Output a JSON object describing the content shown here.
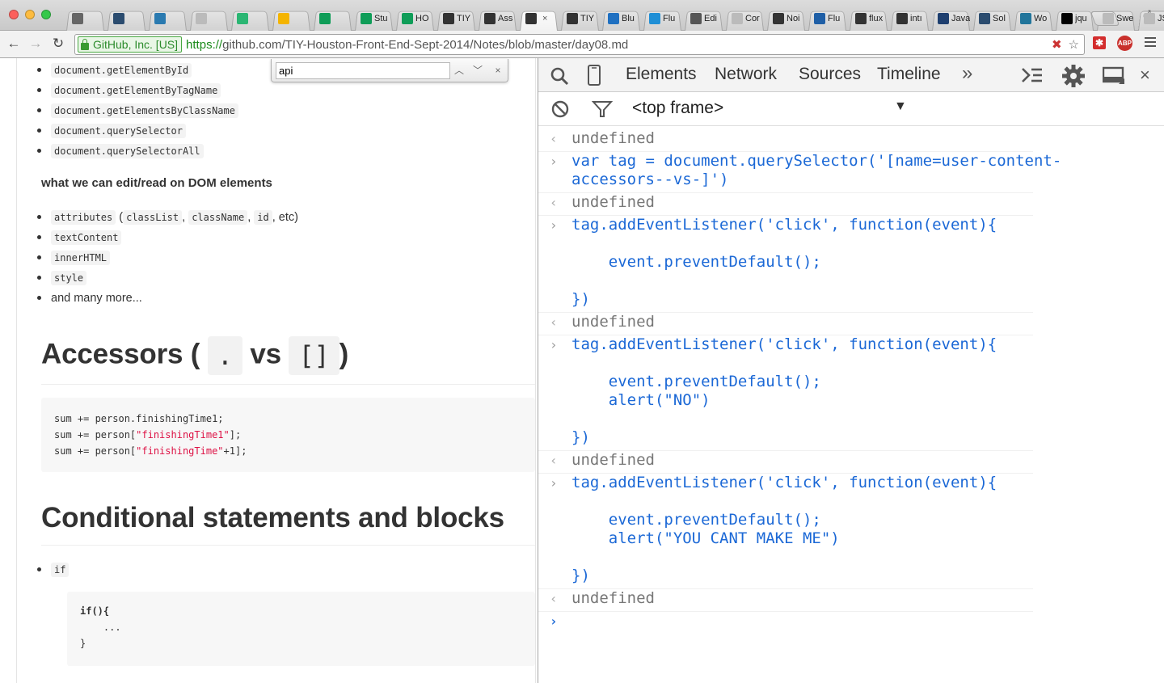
{
  "tabs": [
    {
      "title": "",
      "icon": "home-icon",
      "color": "#666666"
    },
    {
      "title": "",
      "icon": "shield-app-icon",
      "color": "#2b4c6f"
    },
    {
      "title": "",
      "icon": "trello-icon",
      "color": "#2a7ab0"
    },
    {
      "title": "",
      "icon": "document-icon",
      "color": "#bbbbbb"
    },
    {
      "title": "",
      "icon": "cloud-icon",
      "color": "#2bb673"
    },
    {
      "title": "",
      "icon": "drive-icon",
      "color": "#f4b400"
    },
    {
      "title": "",
      "icon": "drive-icon",
      "color": "#0f9d58"
    },
    {
      "title": "Stu",
      "icon": "sheets-icon",
      "color": "#0f9d58"
    },
    {
      "title": "HO",
      "icon": "sheets-icon",
      "color": "#0f9d58"
    },
    {
      "title": "TIY",
      "icon": "github-icon",
      "color": "#333333"
    },
    {
      "title": "Ass",
      "icon": "github-icon",
      "color": "#333333"
    },
    {
      "title": "",
      "icon": "github-icon",
      "color": "#333333",
      "active": true
    },
    {
      "title": "TIY",
      "icon": "github-icon",
      "color": "#333333"
    },
    {
      "title": "Blu",
      "icon": "bluemix-icon",
      "color": "#1f70c1"
    },
    {
      "title": "Flu",
      "icon": "flux-icon",
      "color": "#1f8fd6"
    },
    {
      "title": "Edi",
      "icon": "cloud-icon",
      "color": "#555555"
    },
    {
      "title": "Cor",
      "icon": "document-icon",
      "color": "#bbbbbb"
    },
    {
      "title": "Noi",
      "icon": "noise-icon",
      "color": "#333333"
    },
    {
      "title": "Flu",
      "icon": "react-icon",
      "color": "#1f5fa6"
    },
    {
      "title": "flux",
      "icon": "github-icon",
      "color": "#333333"
    },
    {
      "title": "intı",
      "icon": "github-icon",
      "color": "#333333"
    },
    {
      "title": "Java",
      "icon": "js-icon",
      "color": "#1e3f6f"
    },
    {
      "title": "Sol",
      "icon": "book-icon",
      "color": "#2b4c6f"
    },
    {
      "title": "Wo",
      "icon": "wordpress-icon",
      "color": "#21759b"
    },
    {
      "title": "jqu",
      "icon": "jquery-icon",
      "color": "#000000"
    },
    {
      "title": "Swe",
      "icon": "document-icon",
      "color": "#bbbbbb"
    },
    {
      "title": "JSH",
      "icon": "document-icon",
      "color": "#bbbbbb"
    }
  ],
  "tab_close_glyph": "×",
  "toolbar": {
    "ev_label": "GitHub, Inc. [US]",
    "url_scheme": "https://",
    "url_rest": "github.com/TIY-Houston-Front-End-Sept-2014/Notes/blob/master/day08.md",
    "abp_label": "ABP"
  },
  "find": {
    "query": "api"
  },
  "page": {
    "dom_methods": [
      "document.getElementById",
      "document.getElementByTagName",
      "document.getElementsByClassName",
      "document.querySelector",
      "document.querySelectorAll"
    ],
    "edit_heading": "what we can edit/read on DOM elements",
    "attr_item": {
      "code": "attributes",
      "paren_open": " (",
      "c1": "classList",
      "sep1": ", ",
      "c2": "className",
      "sep2": ", ",
      "c3": "id",
      "tail": ", etc)"
    },
    "props": [
      "textContent",
      "innerHTML",
      "style"
    ],
    "more": "and many more...",
    "accessors_heading": {
      "pre": "Accessors (",
      "dot": ".",
      "vs": "vs",
      "brackets": "[]",
      "post": ")"
    },
    "accessor_code": [
      {
        "a": "sum += person.finishingTime1;",
        "s": "",
        "b": ""
      },
      {
        "a": "sum += person[",
        "s": "\"finishingTime1\"",
        "b": "];"
      },
      {
        "a": "sum += person[",
        "s": "\"finishingTime\"",
        "b": "+1];"
      }
    ],
    "cond_heading": "Conditional statements and blocks",
    "if_label": "if",
    "if_code": [
      "if(){",
      "    ...",
      "}"
    ]
  },
  "devtools": {
    "tabs": [
      "Elements",
      "Network",
      "Sources",
      "Timeline"
    ],
    "more_glyph": "»",
    "frame": "<top frame>",
    "console": [
      {
        "kind": "out",
        "text": "undefined"
      },
      {
        "kind": "in",
        "text": "var tag = document.querySelector('[name=user-content-\naccessors--vs-]')"
      },
      {
        "kind": "out",
        "text": "undefined"
      },
      {
        "kind": "in",
        "text": "tag.addEventListener('click', function(event){\n\n    event.preventDefault();\n\n})"
      },
      {
        "kind": "out",
        "text": "undefined"
      },
      {
        "kind": "in",
        "text": "tag.addEventListener('click', function(event){\n\n    event.preventDefault();\n    alert(\"NO\")\n\n})"
      },
      {
        "kind": "out",
        "text": "undefined"
      },
      {
        "kind": "in",
        "text": "tag.addEventListener('click', function(event){\n\n    event.preventDefault();\n    alert(\"YOU CANT MAKE ME\")\n\n})"
      },
      {
        "kind": "out",
        "text": "undefined"
      }
    ],
    "prompt_glyph": "›",
    "in_glyph": "›",
    "out_glyph": "‹"
  }
}
